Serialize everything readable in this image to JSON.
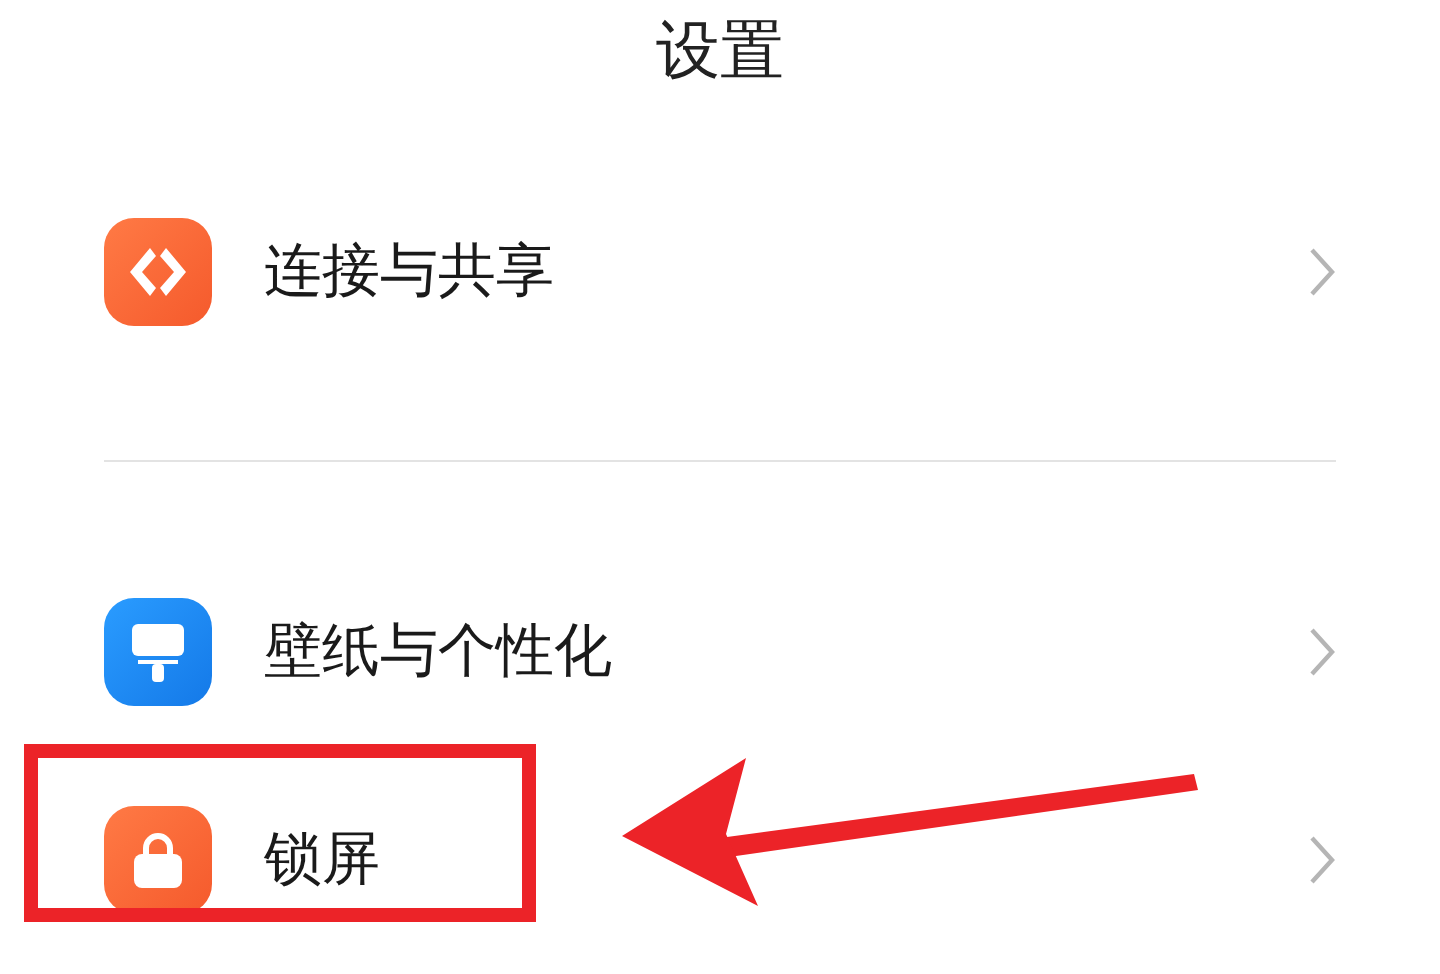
{
  "title": "设置",
  "groups": [
    {
      "items": [
        {
          "label": "连接与共享",
          "kind": "share",
          "highlighted": false
        }
      ]
    },
    {
      "items": [
        {
          "label": "壁纸与个性化",
          "kind": "wallpaper",
          "highlighted": false
        },
        {
          "label": "锁屏",
          "kind": "lock",
          "highlighted": true
        }
      ]
    }
  ]
}
